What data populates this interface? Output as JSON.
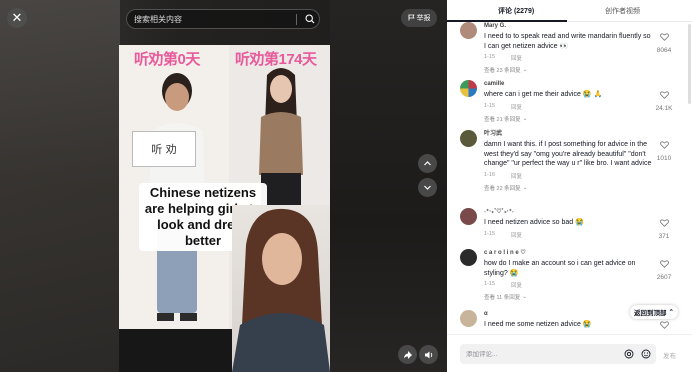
{
  "search": {
    "placeholder": "搜索相关内容"
  },
  "report": {
    "label": "举报"
  },
  "video": {
    "label_left": "听劝第0天",
    "label_right": "听劝第174天",
    "sign_text": "听 劝",
    "caption": "Chinese netizens are helping girls to look and dress better"
  },
  "tabs": {
    "comments_label": "评论 (2279)",
    "creator_label": "创作者视频"
  },
  "comments": [
    {
      "user": "Mary G.",
      "text": "I need to to speak read and write mandarin fluently so I can get netizen advice 👀",
      "date": "1-15",
      "reply": "回复",
      "replies": "查看 23 条回复",
      "likes": "8064",
      "avatar_color": "#b08a7a"
    },
    {
      "user": "camille",
      "text": "where can i get me their advice 😭 🙏",
      "date": "1-15",
      "reply": "回复",
      "replies": "查看 21 条回复",
      "likes": "24.1K",
      "avatar_color": "#c03a4a"
    },
    {
      "user": "叶习武",
      "text": "damn I want this. if I post something for advice in the west they'd say \"omg you're already beautiful\" \"don't change\" \"ur perfect the way u r\" like bro. I want advice",
      "date": "1-16",
      "reply": "回复",
      "replies": "查看 22 条回复",
      "likes": "1010",
      "avatar_color": "#5a5a3a"
    },
    {
      "user": "˖⁺‧₊˚♡˚₊‧⁺˖",
      "text": "I need netizen advice so bad 😭",
      "date": "1-15",
      "reply": "回复",
      "replies": "",
      "likes": "371",
      "avatar_color": "#7a4a4a"
    },
    {
      "user": "c a r o l i n e ♡",
      "text": "how do I make an account so i can get advice on styling? 😭",
      "date": "1-15",
      "reply": "回复",
      "replies": "查看 11 条回复",
      "likes": "2607",
      "avatar_color": "#2a2a2a"
    },
    {
      "user": "α",
      "text": "I need me some netizen advice 😭",
      "date": "1-15",
      "reply": "回复",
      "replies": "",
      "likes": "175",
      "avatar_color": "#c8b49a"
    }
  ],
  "back_to_top": "返回到顶部",
  "reply_bar": {
    "placeholder": "添加评论...",
    "post_label": "发布"
  }
}
